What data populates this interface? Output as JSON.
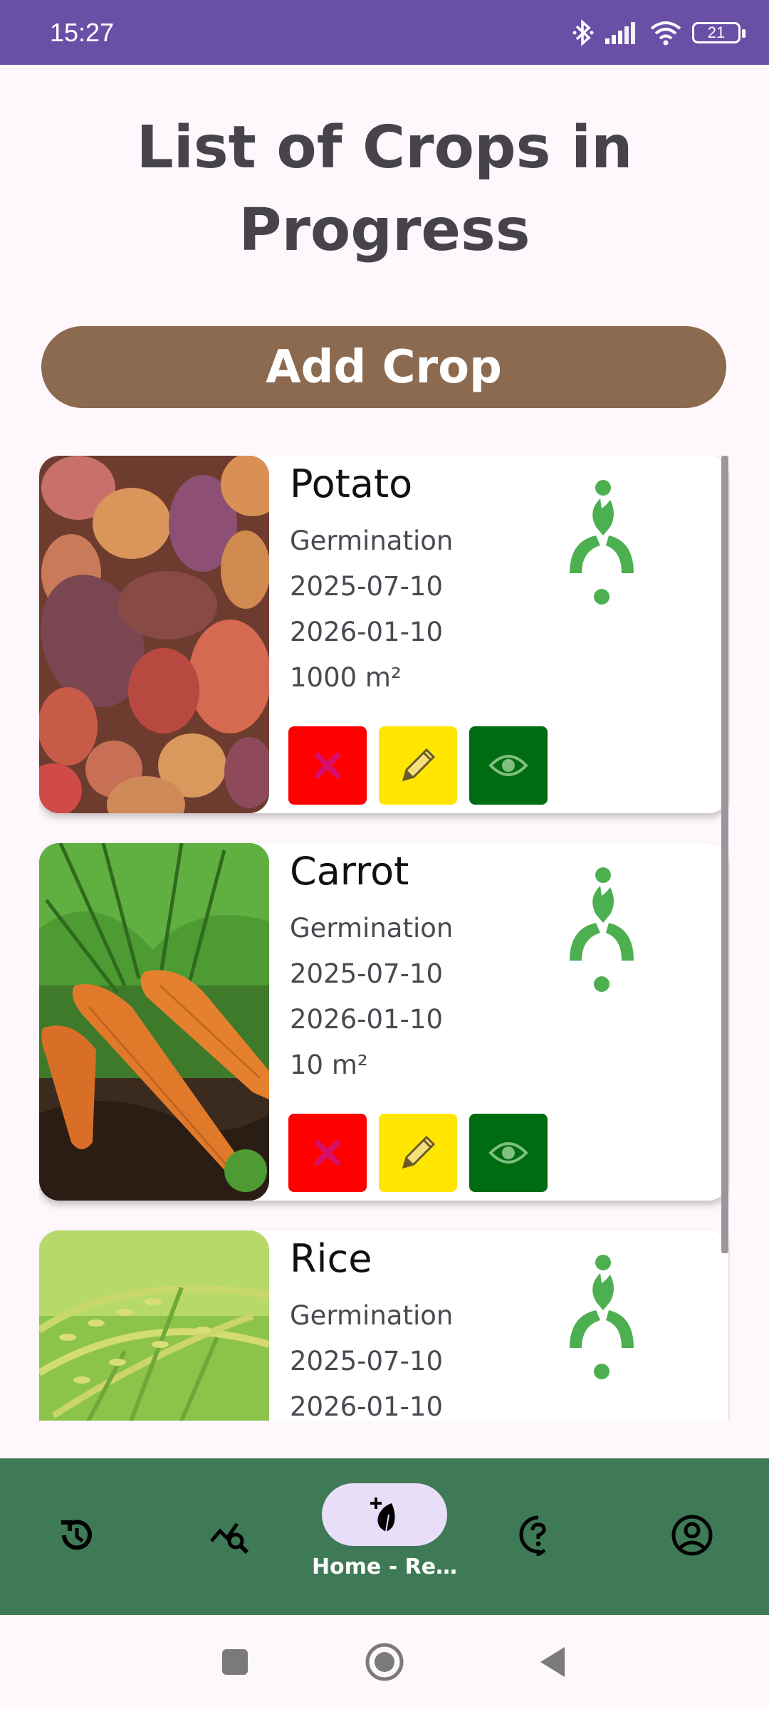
{
  "status_bar": {
    "time": "15:27",
    "battery": "21",
    "icons": [
      "bluetooth-icon",
      "signal-icon",
      "wifi-icon",
      "battery-icon"
    ]
  },
  "page": {
    "title": "List of Crops in Progress"
  },
  "add_crop_button": {
    "label": "Add Crop"
  },
  "crops": [
    {
      "name": "Potato",
      "stage": "Germination",
      "start_date": "2025-07-10",
      "end_date": "2026-01-10",
      "area": "1000 m²",
      "image": "potatoes-photo"
    },
    {
      "name": "Carrot",
      "stage": "Germination",
      "start_date": "2025-07-10",
      "end_date": "2026-01-10",
      "area": "10 m²",
      "image": "carrots-photo"
    },
    {
      "name": "Rice",
      "stage": "Germination",
      "start_date": "2025-07-10",
      "end_date": "2026-01-10",
      "area": "",
      "image": "rice-photo"
    }
  ],
  "actions": {
    "delete_icon": "close-icon",
    "edit_icon": "pencil-icon",
    "view_icon": "eye-icon",
    "colors": {
      "delete": "#ff0000",
      "edit": "#ffe600",
      "view": "#006c12"
    }
  },
  "bottom_nav": {
    "items": [
      {
        "icon": "history-icon",
        "label": ""
      },
      {
        "icon": "chart-search-icon",
        "label": ""
      },
      {
        "icon": "plant-add-icon",
        "label": "Home - Re…",
        "active": true
      },
      {
        "icon": "help-icon",
        "label": ""
      },
      {
        "icon": "account-icon",
        "label": ""
      }
    ],
    "background": "#3f7a57"
  },
  "colors": {
    "status_bar": "#6a4fa6",
    "add_button": "#8b6a50",
    "stage_icon": "#4caf50"
  }
}
